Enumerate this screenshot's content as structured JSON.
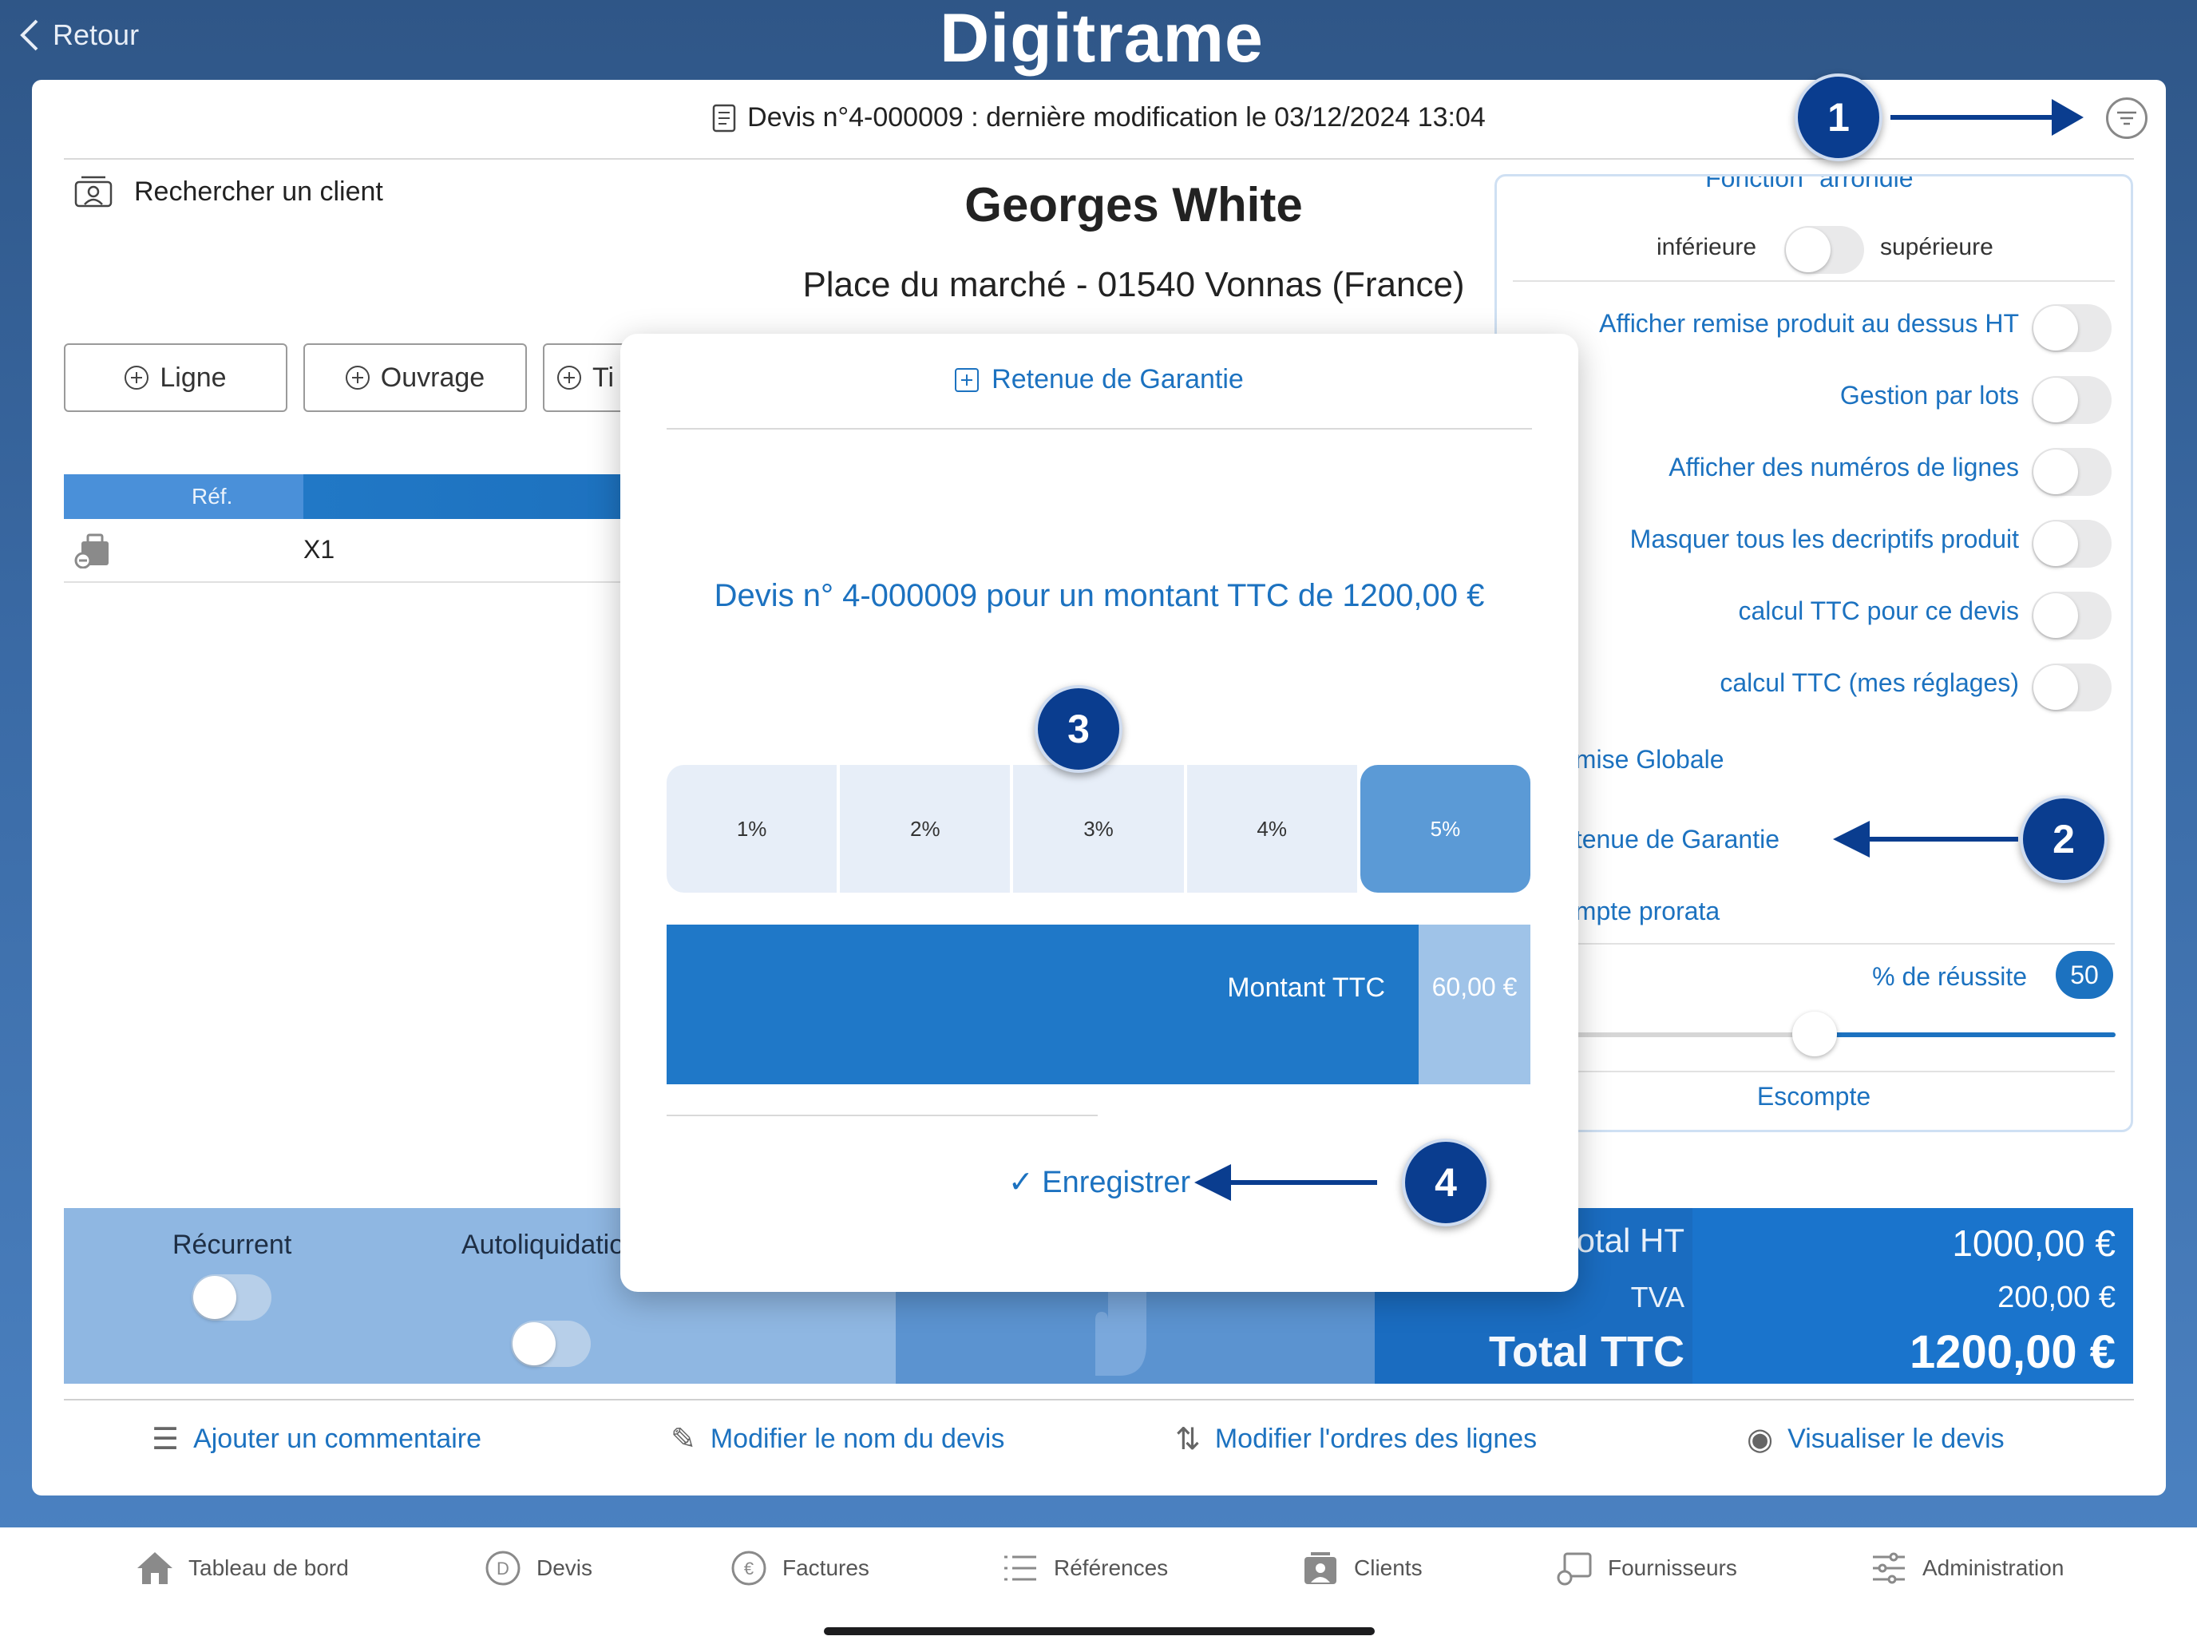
{
  "app": {
    "logo": "Digitrame",
    "back_label": "Retour"
  },
  "document": {
    "title": "Devis n°4-000009 : dernière modification le 03/12/2024 13:04"
  },
  "client": {
    "search_label": "Rechercher un client",
    "name": "Georges White",
    "address": "Place du marché - 01540 Vonnas (France)"
  },
  "toolbar": {
    "add_line": "Ligne",
    "add_ouvrage": "Ouvrage",
    "add_title": "Ti"
  },
  "table": {
    "headers": [
      "Réf."
    ],
    "rows": [
      {
        "ref": "X1"
      }
    ]
  },
  "summary": {
    "recurrent_label": "Récurrent",
    "recurrent_on": false,
    "autoliquidation_label": "Autoliquidatio",
    "autoliquidation_on": false,
    "total_ht_label": "otal HT",
    "total_ht": "1000,00 €",
    "tva_label": "TVA",
    "tva": "200,00 €",
    "total_ttc_label": "Total TTC",
    "total_ttc": "1200,00 €"
  },
  "actions": {
    "comment": "Ajouter un commentaire",
    "rename": "Modifier le nom du devis",
    "reorder": "Modifier l'ordres des lignes",
    "preview": "Visualiser le devis"
  },
  "settings": {
    "partial_header": "Fonction \"arrondie\"",
    "rounding_low": "inférieure",
    "rounding_high": "supérieure",
    "toggles": [
      {
        "label": "Afficher remise produit au dessus HT",
        "on": false
      },
      {
        "label": "Gestion par lots",
        "on": false
      },
      {
        "label": "Afficher des numéros de lignes",
        "on": false
      },
      {
        "label": "Masquer tous les decriptifs produit",
        "on": false
      },
      {
        "label": "calcul TTC pour ce devis",
        "on": false
      },
      {
        "label": "calcul TTC (mes réglages)",
        "on": false
      }
    ],
    "remise_globale": "emise Globale",
    "retenue_garantie": "etenue de Garantie",
    "compte_prorata": "ompte prorata",
    "reussite_label": "% de réussite",
    "reussite_value": "50",
    "reussite_fraction": 0.5,
    "escompte": "Escompte"
  },
  "modal": {
    "title": "Retenue de Garantie",
    "description": "Devis n° 4-000009 pour un montant TTC de 1200,00 €",
    "percent_options": [
      "1%",
      "2%",
      "3%",
      "4%",
      "5%"
    ],
    "selected_percent": "5%",
    "amount_label": "Montant TTC",
    "amount_value": "60,00 €",
    "save_label": "Enregistrer"
  },
  "callouts": {
    "c1": "1",
    "c2": "2",
    "c3": "3",
    "c4": "4"
  },
  "tabs": [
    {
      "label": "Tableau de bord",
      "icon": "home-icon"
    },
    {
      "label": "Devis",
      "icon": "devis-icon"
    },
    {
      "label": "Factures",
      "icon": "euro-icon"
    },
    {
      "label": "Références",
      "icon": "list-icon"
    },
    {
      "label": "Clients",
      "icon": "clients-icon"
    },
    {
      "label": "Fournisseurs",
      "icon": "supplier-icon"
    },
    {
      "label": "Administration",
      "icon": "settings-sliders-icon"
    }
  ],
  "colors": {
    "accent": "#1c72c0",
    "callout": "#0a3d8f",
    "total_bg": "#1a6cc0"
  }
}
